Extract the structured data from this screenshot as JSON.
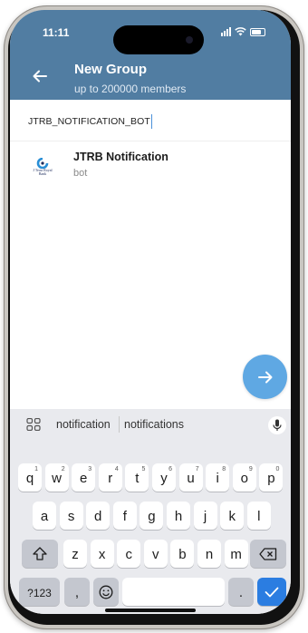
{
  "status_bar": {
    "time": "11:11"
  },
  "header": {
    "title": "New Group",
    "subtitle": "up to 200000 members",
    "accent_color": "#517da2"
  },
  "search": {
    "value": "JTRB_NOTIFICATION_BOT"
  },
  "results": [
    {
      "name": "JTRB Notification",
      "subtitle": "bot",
      "avatar_text_line1": "J Trust Royal",
      "avatar_text_line2": "Bank"
    }
  ],
  "fab": {
    "icon": "arrow-right-icon",
    "color": "#5fa8e3"
  },
  "keyboard": {
    "suggestions": [
      "notification",
      "notifications"
    ],
    "row1": [
      {
        "key": "q",
        "hint": "1"
      },
      {
        "key": "w",
        "hint": "2"
      },
      {
        "key": "e",
        "hint": "3"
      },
      {
        "key": "r",
        "hint": "4"
      },
      {
        "key": "t",
        "hint": "5"
      },
      {
        "key": "y",
        "hint": "6"
      },
      {
        "key": "u",
        "hint": "7"
      },
      {
        "key": "i",
        "hint": "8"
      },
      {
        "key": "o",
        "hint": "9"
      },
      {
        "key": "p",
        "hint": "0"
      }
    ],
    "row2": [
      "a",
      "s",
      "d",
      "f",
      "g",
      "h",
      "j",
      "k",
      "l"
    ],
    "row3": [
      "z",
      "x",
      "c",
      "v",
      "b",
      "n",
      "m"
    ],
    "symbols_label": "?123",
    "comma_label": ",",
    "period_label": ".",
    "enter_color": "#2b7de1"
  }
}
